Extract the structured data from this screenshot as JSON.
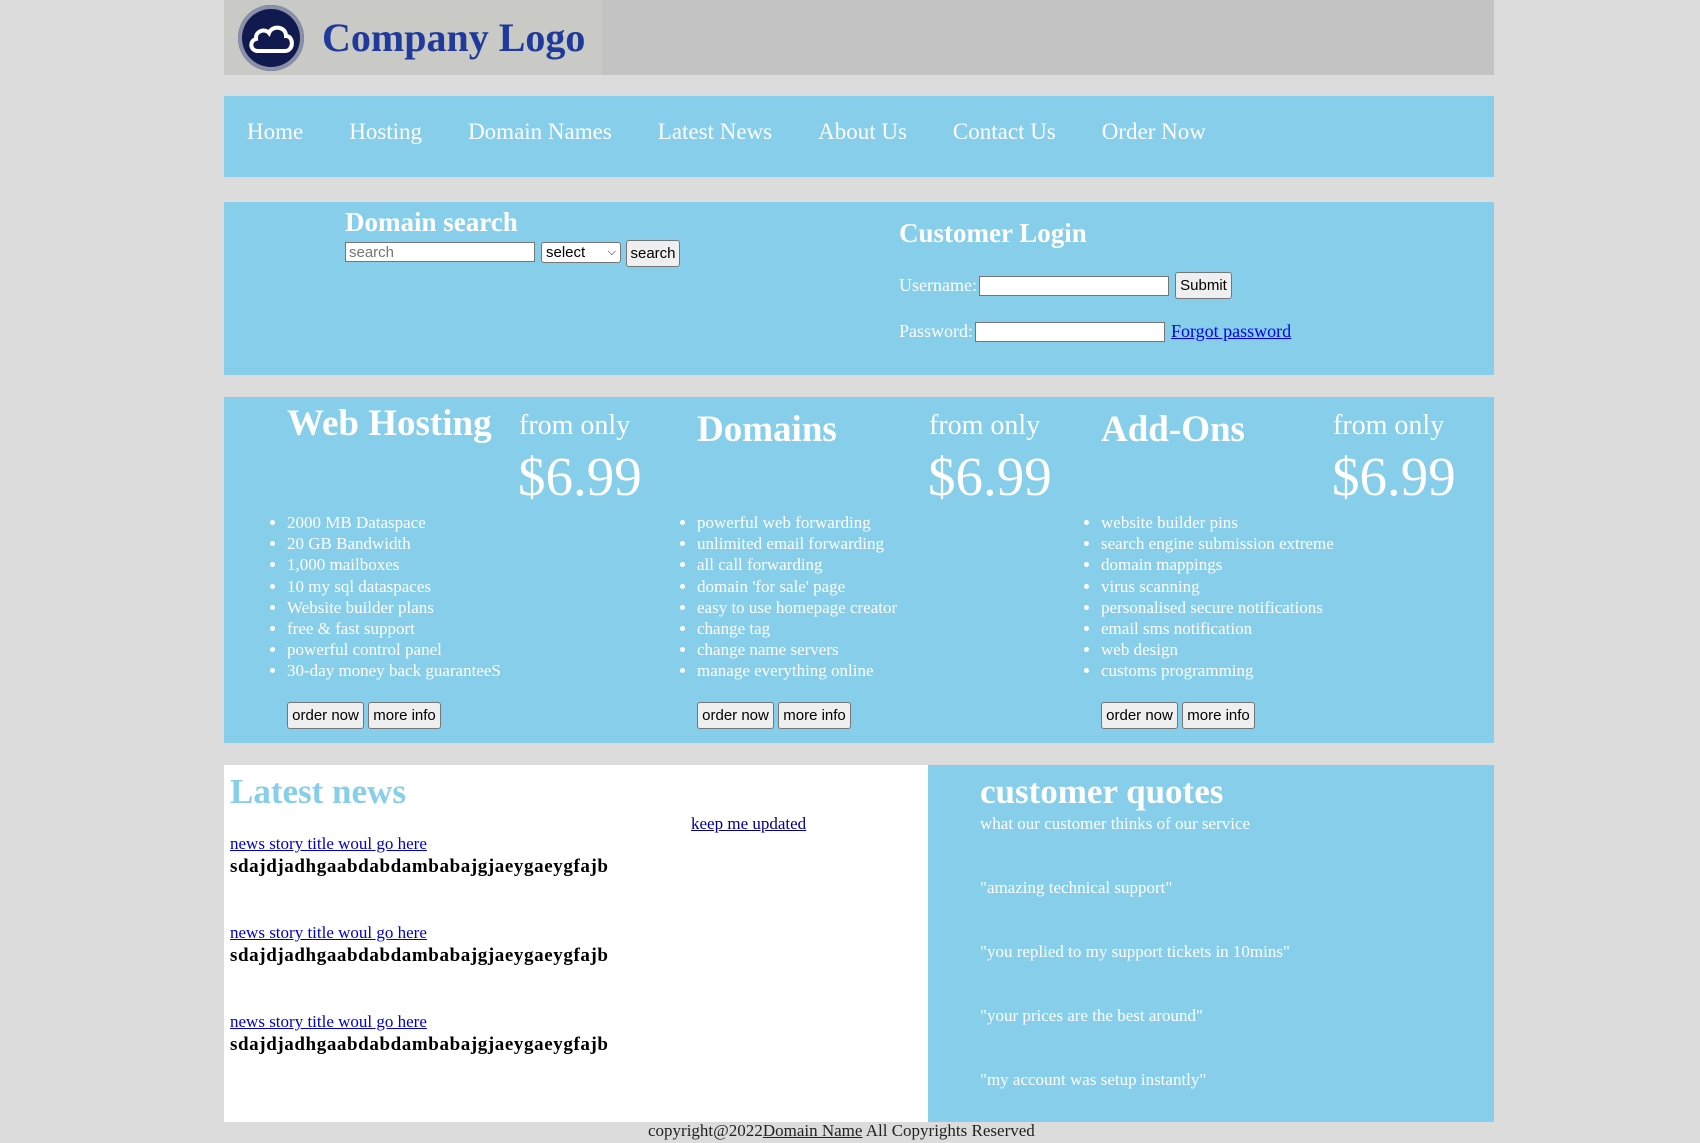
{
  "header": {
    "logo_text": "Company Logo"
  },
  "nav": {
    "items": [
      "Home",
      "Hosting",
      "Domain Names",
      "Latest News",
      "About Us",
      "Contact Us",
      "Order Now"
    ]
  },
  "search": {
    "title": "Domain search",
    "placeholder": "search",
    "select_value": "select",
    "button_label": "search"
  },
  "login": {
    "title": "Customer Login",
    "username_label": "Username:",
    "password_label": "Password:",
    "submit_label": "Submit",
    "forgot_label": "Forgot password"
  },
  "products": [
    {
      "title": "Web Hosting",
      "from_label": "from only",
      "price": "$6.99",
      "features": [
        "2000 MB Dataspace",
        "20 GB Bandwidth",
        "1,000 mailboxes",
        "10 my sql dataspaces",
        "Website builder plans",
        "free & fast support",
        "powerful control panel",
        "30-day money back guaranteeS"
      ],
      "order_label": "order now",
      "info_label": "more info"
    },
    {
      "title": "Domains",
      "from_label": "from only",
      "price": "$6.99",
      "features": [
        "powerful web forwarding",
        "unlimited email forwarding",
        "all call forwarding",
        "domain 'for sale' page",
        "easy to use homepage creator",
        "change tag",
        "change name servers",
        "manage everything online"
      ],
      "order_label": "order now",
      "info_label": "more info"
    },
    {
      "title": "Add-Ons",
      "from_label": "from only",
      "price": "$6.99",
      "features": [
        "website builder pins",
        "search engine submission extreme",
        "domain mappings",
        "virus scanning",
        "personalised secure notifications",
        "email sms notification",
        "web design",
        "customs programming"
      ],
      "order_label": "order now",
      "info_label": "more info"
    }
  ],
  "news": {
    "title": "Latest news",
    "keep_updated": "keep me updated",
    "stories": [
      {
        "link": "news story title woul go here",
        "body": "sdajdjadhgaabdabdambabajgjaeygaeygfajb"
      },
      {
        "link": "news story title woul go here",
        "body": "sdajdjadhgaabdabdambabajgjaeygaeygfajb"
      },
      {
        "link": "news story title woul go here",
        "body": "sdajdjadhgaabdabdambabajgjaeygaeygfajb"
      }
    ]
  },
  "quotes": {
    "title": "customer quotes",
    "subtitle": "what our customer thinks of our service",
    "items": [
      "\"amazing technical support\"",
      "\"you replied to my support tickets in 10mins\"",
      "\"your prices are the best around\"",
      "\"my account was setup instantly\""
    ]
  },
  "footer": {
    "prefix": "copyright@2022",
    "link": "Domain Name",
    "suffix": " All Copyrights Reserved"
  },
  "colors": {
    "accent": "#87ceeb",
    "page_bg": "#dcdcdc",
    "header_bg": "#c3c3c3",
    "link": "#0000ee"
  }
}
